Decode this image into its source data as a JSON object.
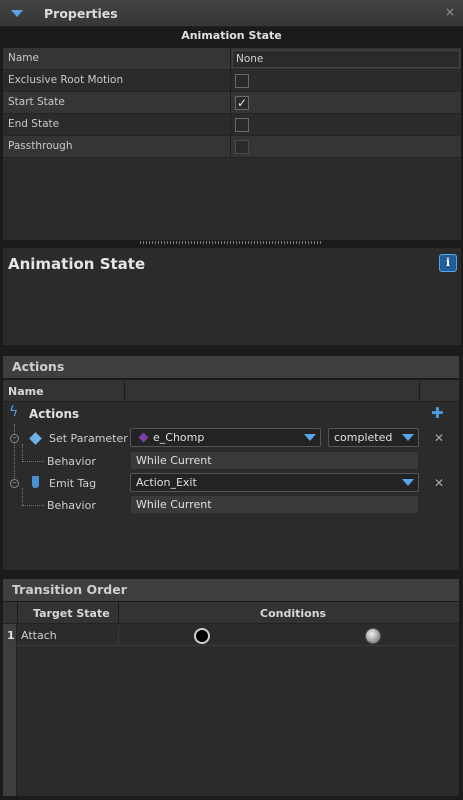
{
  "window": {
    "title": "Properties",
    "close_glyph": "×"
  },
  "animation_state_section": {
    "header": "Animation State"
  },
  "properties": [
    {
      "label": "Name",
      "kind": "text",
      "value": "None"
    },
    {
      "label": "Exclusive Root Motion",
      "kind": "checkbox",
      "checked": false
    },
    {
      "label": "Start State",
      "kind": "checkbox",
      "checked": true
    },
    {
      "label": "End State",
      "kind": "checkbox",
      "checked": false
    },
    {
      "label": "Passthrough",
      "kind": "checkbox",
      "checked": false,
      "disabled": true
    }
  ],
  "info_panel": {
    "heading": "Animation State",
    "info_glyph": "i"
  },
  "actions": {
    "panel_title": "Actions",
    "column_name": "Name",
    "group_label": "Actions",
    "set_parameter": {
      "label": "Set Parameter",
      "parameter_value": "e_Chomp",
      "state_value": "completed",
      "behavior_label": "Behavior",
      "behavior_value": "While Current"
    },
    "emit_tag": {
      "label": "Emit Tag",
      "tag_value": "Action_Exit",
      "behavior_label": "Behavior",
      "behavior_value": "While Current"
    },
    "add_glyph": "✚",
    "remove_glyph": "✕",
    "collapse_glyph": "–"
  },
  "transition_order": {
    "panel_title": "Transition Order",
    "col_target": "Target State",
    "col_conditions": "Conditions",
    "rows": [
      {
        "num": "1",
        "target": "Attach"
      }
    ]
  },
  "colors": {
    "accent": "#5aa4e6",
    "background": "#1b1b1b",
    "panel": "#2b2b2b",
    "header": "#3f3f3f"
  }
}
